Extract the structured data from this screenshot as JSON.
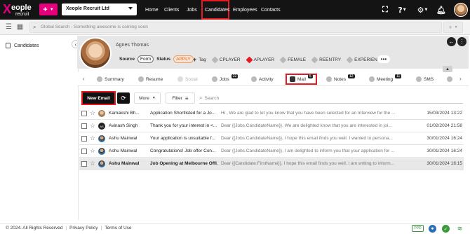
{
  "brand": {
    "logo_word": "eople",
    "logo_sub": "recruit"
  },
  "header": {
    "company": "Xeople Recruit Ltd",
    "nav": [
      "Home",
      "Clients",
      "Jobs",
      "Candidates",
      "Employees",
      "Contacts"
    ],
    "active_nav": "Candidates"
  },
  "search": {
    "placeholder": "Global Search - Something awesome is coming soon"
  },
  "sidebar": {
    "items": [
      {
        "label": "Candidates",
        "icon": "candidates-icon"
      }
    ]
  },
  "candidate": {
    "name": "Agnes Thomas",
    "source_label": "Source",
    "source_value": "Form",
    "status_label": "Status",
    "status_value": "APPLY",
    "add_tag_label": "Tag",
    "tags": [
      "CPLAYER",
      "APLAYER",
      "FEMALE",
      "REENTRY",
      "EXPERIENC..."
    ],
    "more_label": "•••"
  },
  "tabs": [
    {
      "label": "Summary",
      "badge": ""
    },
    {
      "label": "Resume",
      "badge": ""
    },
    {
      "label": "Social",
      "badge": ""
    },
    {
      "label": "Jobs",
      "badge": "22"
    },
    {
      "label": "Activity",
      "badge": ""
    },
    {
      "label": "Mail",
      "badge": "5"
    },
    {
      "label": "Notes",
      "badge": "12"
    },
    {
      "label": "Meeting",
      "badge": "11"
    },
    {
      "label": "SMS",
      "badge": ""
    }
  ],
  "toolbar": {
    "new_email": "New Email",
    "more": "More",
    "filter": "Filter",
    "search_placeholder": "Search"
  },
  "mails": [
    {
      "from": "Kamakshi Bh...",
      "avatar": "photo",
      "subject": "Application Shortlisted for a Jo...",
      "snippet": "Hi , We are glad to let you know that you have been selected for an Interview for the ...",
      "date": "15/03/2024 13:22",
      "selected": false
    },
    {
      "from": "Avinash Singh",
      "avatar": "AS",
      "subject": "Thank you for your interest in <...",
      "snippet": "Dear {{Jobs.CandidateName}}, We are delighted know that you are interested in joi...",
      "date": "01/02/2024 21:58",
      "selected": false
    },
    {
      "from": "Ashu Mainwal",
      "avatar": "man",
      "subject": "Your application is unsuitable f...",
      "snippet": "Dear {{Jobs.CandidateName}}, I hope this email finds you well. I wanted to persona...",
      "date": "30/01/2024 16:24",
      "selected": false
    },
    {
      "from": "Ashu Mainwal",
      "avatar": "man",
      "subject": "Congratulations! Job offer Con...",
      "snippet": "Dear {{Jobs.CandidateName}}, I am delighted to inform you that your application for ...",
      "date": "30/01/2024 16:24",
      "selected": false
    },
    {
      "from": "Ashu Mainwal",
      "avatar": "man",
      "subject": "Job Opening at Melbourne Offi...",
      "snippet": "Dear {{Candidate.FirstName}}, I hope this email finds you well. I am writing to inform...",
      "date": "30/01/2024 16:15",
      "selected": true
    }
  ],
  "footer": {
    "copyright": "© 2024. All Rights Reserved",
    "privacy": "Privacy Policy",
    "terms": "Terms of Use",
    "ppd": "PPD"
  },
  "colors": {
    "accent": "#e4007c",
    "highlight": "#e51b24",
    "topbar": "#141414"
  }
}
